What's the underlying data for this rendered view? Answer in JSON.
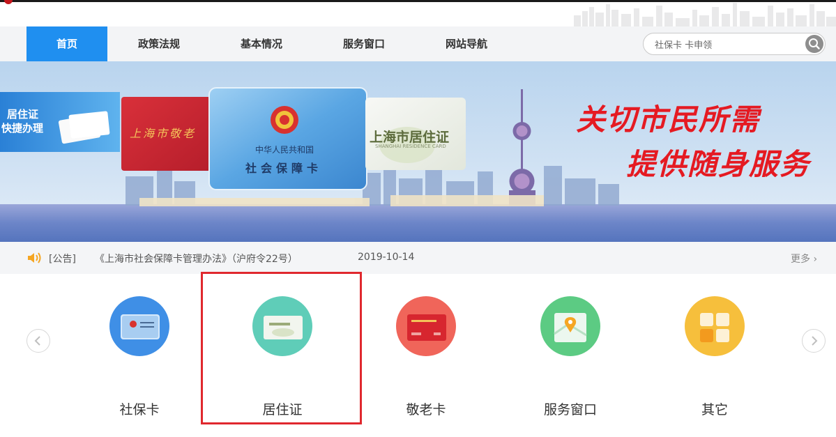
{
  "nav": {
    "items": [
      {
        "label": "首页",
        "active": true
      },
      {
        "label": "政策法规",
        "active": false
      },
      {
        "label": "基本情况",
        "active": false
      },
      {
        "label": "服务窗口",
        "active": false
      },
      {
        "label": "网站导航",
        "active": false
      }
    ],
    "active_color": "#1f8ff0"
  },
  "search": {
    "value": "社保卡 卡申领",
    "icon": "search-icon"
  },
  "banner": {
    "slogan_line1": "关切市民所需",
    "slogan_line2": "提供随身服务",
    "slogan_color": "#e51a22",
    "residence_quick": {
      "line1": "居住证",
      "line2": "快捷办理"
    },
    "elder_card_title": "上海市敬老",
    "social_card": {
      "country": "中华人民共和国",
      "name": "社会保障卡"
    },
    "residence_card": {
      "title": "上海市居住证",
      "subtitle": "SHANGHAI RESIDENCE CARD"
    }
  },
  "notice": {
    "tag": "[公告]",
    "title": "《上海市社会保障卡管理办法》（沪府令22号）",
    "date": "2019-10-14",
    "more": "更多 ›",
    "icon": "speaker-icon"
  },
  "services": [
    {
      "label": "社保卡",
      "color": "#3f8fe6",
      "icon": "social-security-card-icon"
    },
    {
      "label": "居住证",
      "color": "#5fcdb8",
      "icon": "residence-permit-icon"
    },
    {
      "label": "敬老卡",
      "color": "#f0655a",
      "icon": "elder-card-icon"
    },
    {
      "label": "服务窗口",
      "color": "#5ccb83",
      "icon": "map-location-icon"
    },
    {
      "label": "其它",
      "color": "#f6bf3c",
      "icon": "grid-other-icon"
    }
  ],
  "carousel": {
    "prev": "‹",
    "next": "›"
  },
  "highlight_color": "#e0282e"
}
